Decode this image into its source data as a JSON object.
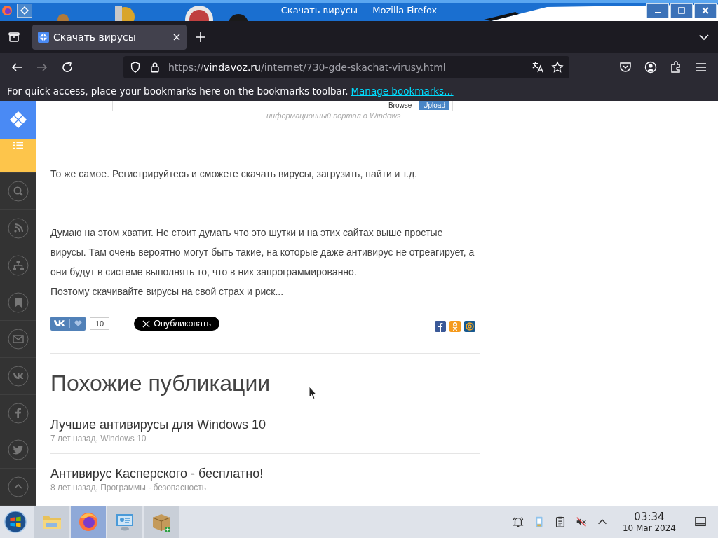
{
  "window": {
    "title": "Скачать вирусы — Mozilla Firefox"
  },
  "tabs": [
    {
      "label": "Скачать вирусы",
      "selected": true
    }
  ],
  "address_bar": {
    "scheme": "https://",
    "domain": "vindavoz.ru",
    "path": "/internet/730-gde-skachat-virusy.html"
  },
  "bookmarks_bar": {
    "message": "For quick access, place your bookmarks here on the bookmarks toolbar.",
    "link": "Manage bookmarks…"
  },
  "sidebar": {
    "items": [
      {
        "kind": "logo"
      },
      {
        "kind": "list",
        "selected": true
      },
      {
        "kind": "search",
        "selected": false
      },
      {
        "kind": "rss",
        "selected": false
      },
      {
        "kind": "sitemap",
        "selected": false
      },
      {
        "kind": "bookmark",
        "selected": false
      },
      {
        "kind": "mail",
        "selected": false
      },
      {
        "kind": "vk",
        "selected": false
      },
      {
        "kind": "facebook",
        "selected": false
      },
      {
        "kind": "twitter",
        "selected": false
      },
      {
        "kind": "up",
        "selected": false
      }
    ]
  },
  "article": {
    "screenshot": {
      "browse": "Browse",
      "upload": "Upload",
      "caption": "информационный портал о Windows"
    },
    "paragraphs": [
      "То же самое. Регистрируйтесь и сможете скачать вирусы, загрузить, найти и т.д.",
      "Думаю на этом хватит. Не стоит думать что это шутки и на этих сайтах выше простые вирусы. Там очень вероятно могут быть такие, на которые даже антивирус не отреагирует, а они будут в системе выполнять то, что в них запрограммированно.",
      "Поэтому скачивайте вирусы на свой страх и риск..."
    ],
    "share": {
      "vk_count": "10",
      "x_button": "Опубликовать",
      "icons": [
        {
          "kind": "facebook",
          "color": "#3b5998"
        },
        {
          "kind": "odnoklassniki",
          "color": "#f59a1c"
        },
        {
          "kind": "mail",
          "color": "#16588e"
        }
      ]
    },
    "related": {
      "heading": "Похожие публикации",
      "items": [
        {
          "title": "Лучшие антивирусы для Windows 10",
          "meta": "7 лет назад, Windows 10"
        },
        {
          "title": "Антивирус Касперского - бесплатно!",
          "meta": "8 лет назад, Программы - безопасность"
        }
      ]
    }
  },
  "taskbar": {
    "apps": [
      {
        "kind": "folder",
        "selected": false
      },
      {
        "kind": "firefox",
        "selected": true
      },
      {
        "kind": "remote",
        "selected": false
      },
      {
        "kind": "package",
        "selected": false
      }
    ],
    "tray": [
      {
        "kind": "bell"
      },
      {
        "kind": "clipboard-app"
      },
      {
        "kind": "clipboard"
      },
      {
        "kind": "muted"
      },
      {
        "kind": "chevron"
      }
    ],
    "time": "03:34",
    "date": "10 Mar 2024"
  }
}
